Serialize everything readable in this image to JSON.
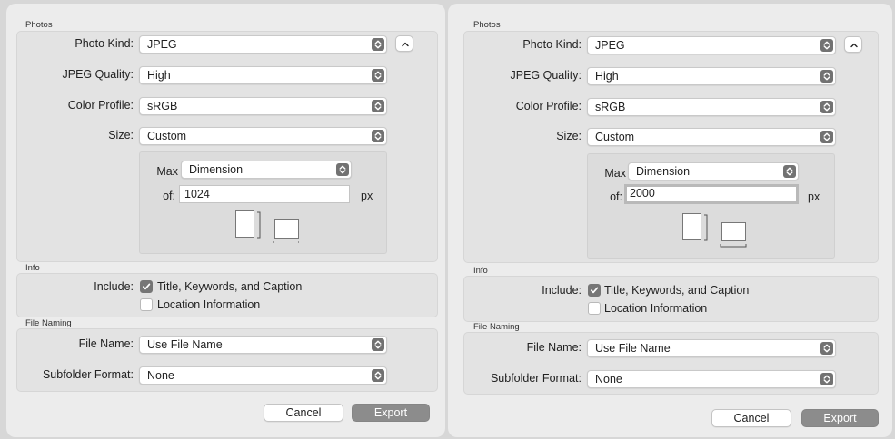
{
  "left": {
    "sections": {
      "photos": "Photos",
      "info": "Info",
      "file_naming": "File Naming"
    },
    "photo_kind": {
      "label": "Photo Kind:",
      "value": "JPEG"
    },
    "jpeg_quality": {
      "label": "JPEG Quality:",
      "value": "High"
    },
    "color_profile": {
      "label": "Color Profile:",
      "value": "sRGB"
    },
    "size": {
      "label": "Size:",
      "value": "Custom"
    },
    "max": {
      "label": "Max",
      "value": "Dimension"
    },
    "of": {
      "label": "of:",
      "value": "1024",
      "unit": "px"
    },
    "include": {
      "label": "Include:",
      "title_keywords": "Title, Keywords, and Caption",
      "title_keywords_checked": true,
      "location": "Location Information",
      "location_checked": false
    },
    "file_name": {
      "label": "File Name:",
      "value": "Use File Name"
    },
    "subfolder": {
      "label": "Subfolder Format:",
      "value": "None"
    },
    "buttons": {
      "cancel": "Cancel",
      "export": "Export"
    }
  },
  "right": {
    "sections": {
      "photos": "Photos",
      "info": "Info",
      "file_naming": "File Naming"
    },
    "photo_kind": {
      "label": "Photo Kind:",
      "value": "JPEG"
    },
    "jpeg_quality": {
      "label": "JPEG Quality:",
      "value": "High"
    },
    "color_profile": {
      "label": "Color Profile:",
      "value": "sRGB"
    },
    "size": {
      "label": "Size:",
      "value": "Custom"
    },
    "max": {
      "label": "Max",
      "value": "Dimension"
    },
    "of": {
      "label": "of:",
      "value": "2000",
      "unit": "px"
    },
    "include": {
      "label": "Include:",
      "title_keywords": "Title, Keywords, and Caption",
      "title_keywords_checked": true,
      "location": "Location Information",
      "location_checked": false
    },
    "file_name": {
      "label": "File Name:",
      "value": "Use File Name"
    },
    "subfolder": {
      "label": "Subfolder Format:",
      "value": "None"
    },
    "buttons": {
      "cancel": "Cancel",
      "export": "Export"
    }
  },
  "icons": {
    "stepper": "up-down-chevron-icon",
    "disclosure": "chevron-up-icon",
    "checkbox": "checkmark-icon",
    "orientation": "portrait-landscape-icon"
  },
  "colors": {
    "dialog_bg": "#ececec",
    "group_bg": "#e3e3e3",
    "control_accent": "#767676",
    "export_button": "#8c8c8c"
  }
}
